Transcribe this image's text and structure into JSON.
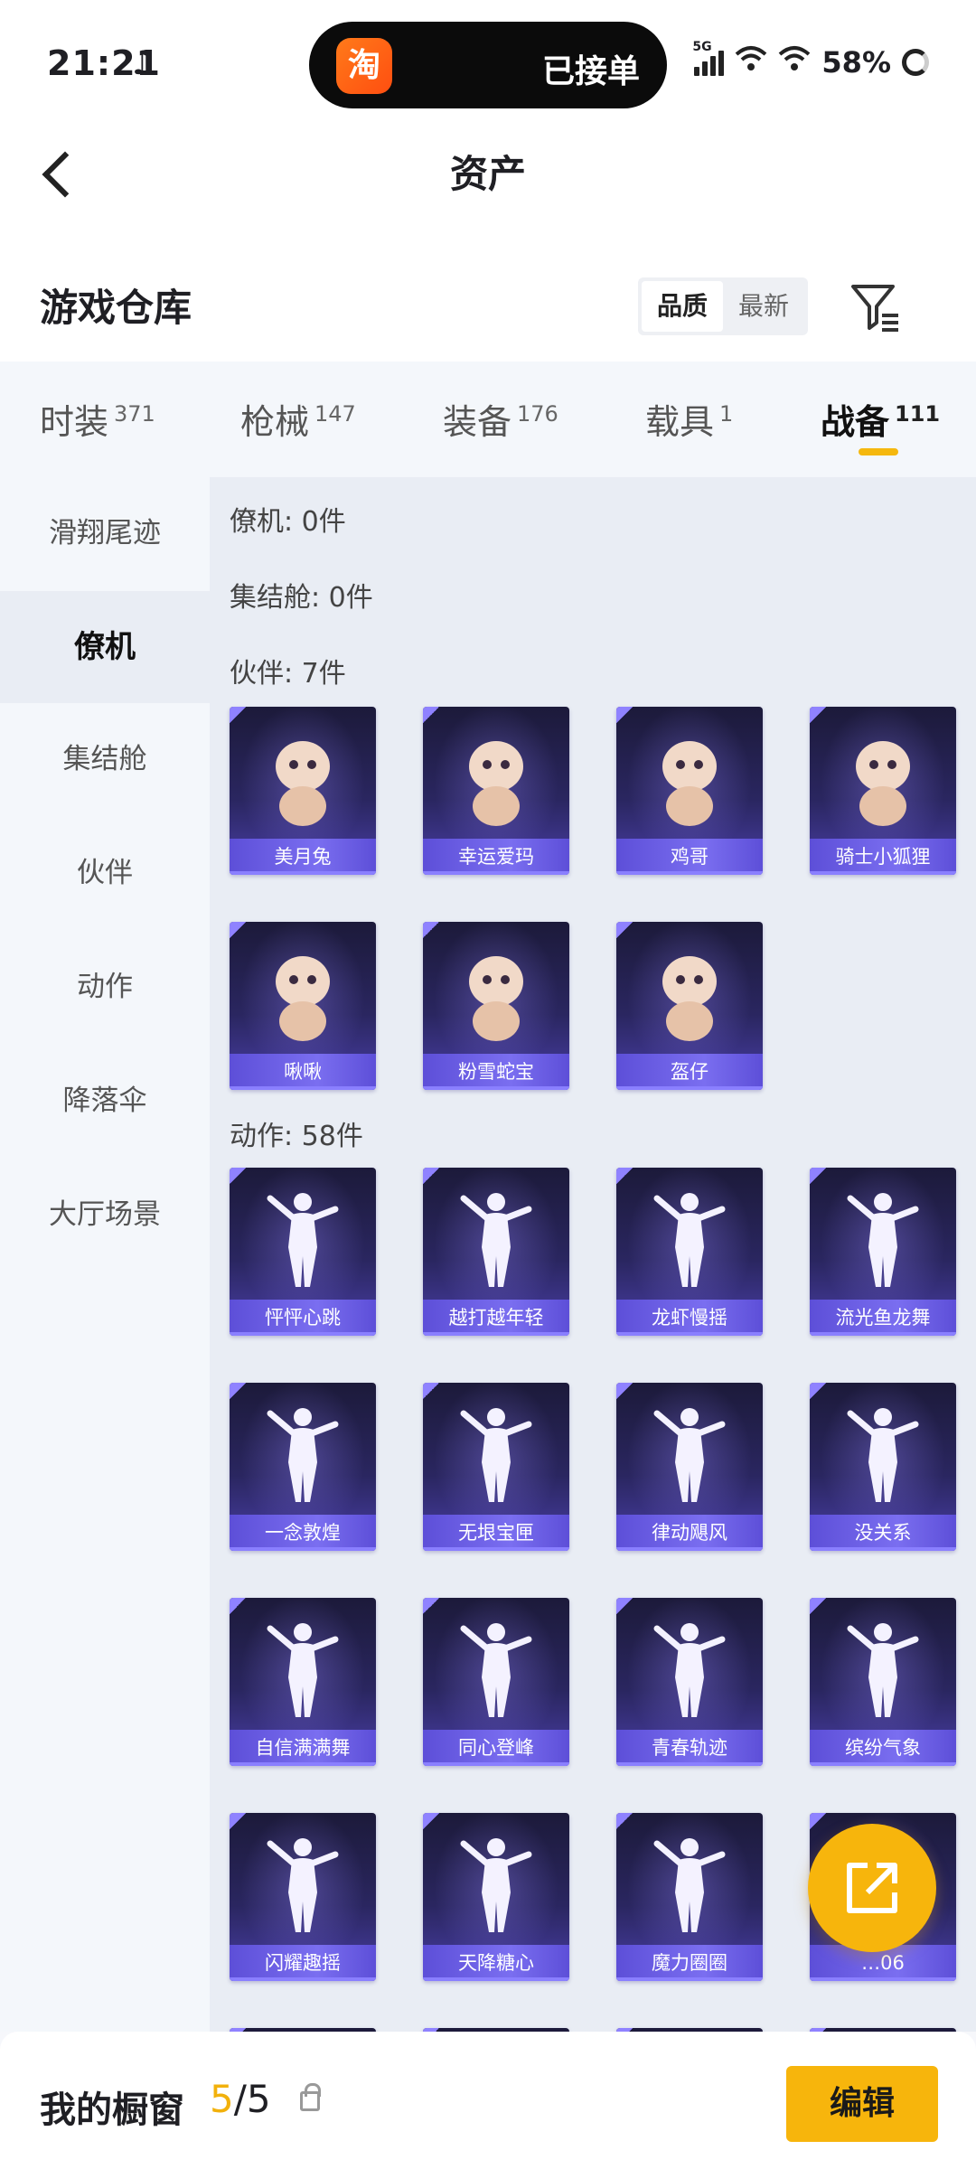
{
  "status_bar": {
    "time": "21:21",
    "island_text": "已接单",
    "taobao_glyph": "淘",
    "network": "5G",
    "battery": "58%"
  },
  "header": {
    "title": "资产"
  },
  "warehouse": {
    "title": "游戏仓库",
    "sort_options": [
      "品质",
      "最新"
    ],
    "active_sort": "品质"
  },
  "category_tabs": [
    {
      "label": "时装",
      "count": "371"
    },
    {
      "label": "枪械",
      "count": "147"
    },
    {
      "label": "装备",
      "count": "176"
    },
    {
      "label": "载具",
      "count": "1"
    },
    {
      "label": "战备",
      "count": "111"
    }
  ],
  "active_tab": "战备",
  "sidebar": {
    "items": [
      "滑翔尾迹",
      "僚机",
      "集结舱",
      "伙伴",
      "动作",
      "降落伞",
      "大厅场景"
    ],
    "active": "僚机"
  },
  "sections": [
    {
      "label": "僚机: 0件",
      "items": []
    },
    {
      "label": "集结舱: 0件",
      "items": []
    },
    {
      "label": "伙伴: 7件",
      "items": [
        "美月兔",
        "幸运爱玛",
        "鸡哥",
        "骑士小狐狸",
        "啾啾",
        "粉雪蛇宝",
        "盔仔"
      ]
    },
    {
      "label": "动作: 58件",
      "items": [
        "怦怦心跳",
        "越打越年轻",
        "龙虾慢摇",
        "流光鱼龙舞",
        "一念敦煌",
        "无垠宝匣",
        "律动飓风",
        "没关系",
        "自信满满舞",
        "同心登峰",
        "青春轨迹",
        "缤纷气象",
        "闪耀趣摇",
        "天降糖心",
        "魔力圈圈",
        "…06"
      ]
    }
  ],
  "bottom_bar": {
    "showcase_label": "我的橱窗",
    "count_current": "5",
    "count_total": "/5",
    "edit_label": "编辑"
  },
  "colors": {
    "accent": "#f7b50c",
    "card_top": "#1c1a3a",
    "card_bottom": "#4a3fa8",
    "name_bar": "#6a5ee8"
  }
}
